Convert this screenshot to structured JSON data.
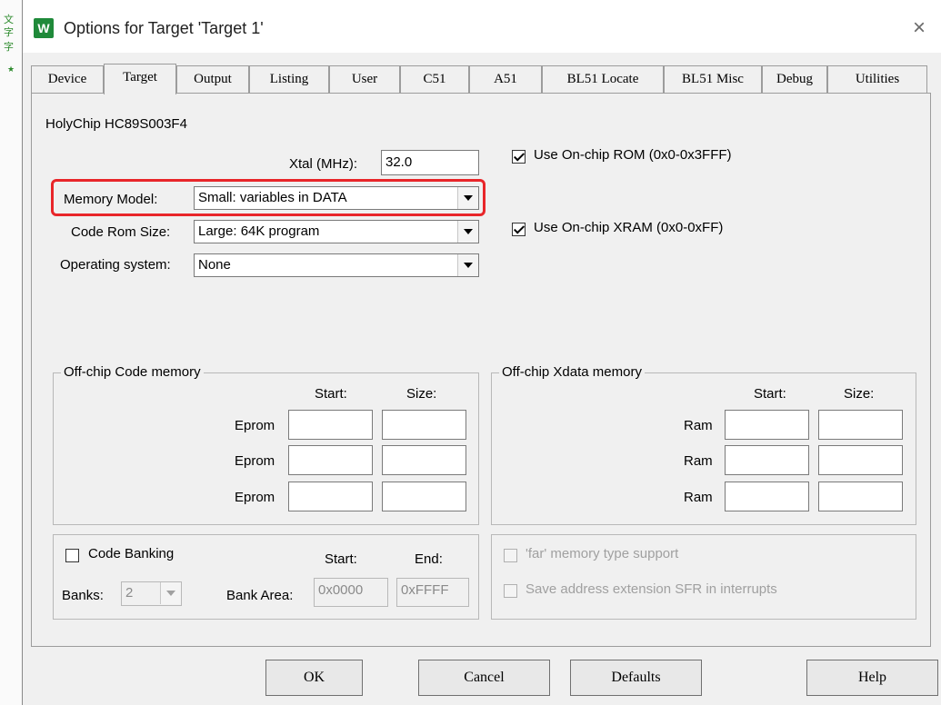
{
  "window": {
    "title": "Options for Target 'Target 1'",
    "app_icon_letter": "W",
    "close_glyph": "×"
  },
  "tabs": [
    {
      "label": "Device",
      "active": false
    },
    {
      "label": "Target",
      "active": true
    },
    {
      "label": "Output",
      "active": false
    },
    {
      "label": "Listing",
      "active": false
    },
    {
      "label": "User",
      "active": false
    },
    {
      "label": "C51",
      "active": false
    },
    {
      "label": "A51",
      "active": false
    },
    {
      "label": "BL51 Locate",
      "active": false
    },
    {
      "label": "BL51 Misc",
      "active": false
    },
    {
      "label": "Debug",
      "active": false
    },
    {
      "label": "Utilities",
      "active": false
    }
  ],
  "target": {
    "device_name": "HolyChip HC89S003F4",
    "xtal_label": "Xtal (MHz):",
    "xtal_value": "32.0",
    "memory_model_label": "Memory Model:",
    "memory_model_value": "Small: variables in DATA",
    "code_rom_size_label": "Code Rom Size:",
    "code_rom_size_value": "Large: 64K program",
    "operating_system_label": "Operating system:",
    "operating_system_value": "None",
    "use_onchip_rom_label": "Use On-chip ROM (0x0-0x3FFF)",
    "use_onchip_rom_checked": true,
    "use_onchip_xram_label": "Use On-chip XRAM (0x0-0xFF)",
    "use_onchip_xram_checked": true
  },
  "offchip_code": {
    "title": "Off-chip Code memory",
    "start_header": "Start:",
    "size_header": "Size:",
    "rows": [
      {
        "label": "Eprom",
        "start": "",
        "size": ""
      },
      {
        "label": "Eprom",
        "start": "",
        "size": ""
      },
      {
        "label": "Eprom",
        "start": "",
        "size": ""
      }
    ]
  },
  "offchip_xdata": {
    "title": "Off-chip Xdata memory",
    "start_header": "Start:",
    "size_header": "Size:",
    "rows": [
      {
        "label": "Ram",
        "start": "",
        "size": ""
      },
      {
        "label": "Ram",
        "start": "",
        "size": ""
      },
      {
        "label": "Ram",
        "start": "",
        "size": ""
      }
    ]
  },
  "banking": {
    "code_banking_label": "Code Banking",
    "code_banking_checked": false,
    "start_header": "Start:",
    "end_header": "End:",
    "banks_label": "Banks:",
    "banks_value": "2",
    "bank_area_label": "Bank Area:",
    "bank_area_start": "0x0000",
    "bank_area_end": "0xFFFF"
  },
  "far": {
    "far_memory_label": "'far' memory type support",
    "save_address_label": "Save address extension SFR in interrupts"
  },
  "buttons": {
    "ok": "OK",
    "cancel": "Cancel",
    "defaults": "Defaults",
    "help": "Help"
  },
  "colors": {
    "highlight": "#e8262a",
    "app_icon": "#1f8a3a",
    "dialog_bg": "#f0f0f0"
  }
}
